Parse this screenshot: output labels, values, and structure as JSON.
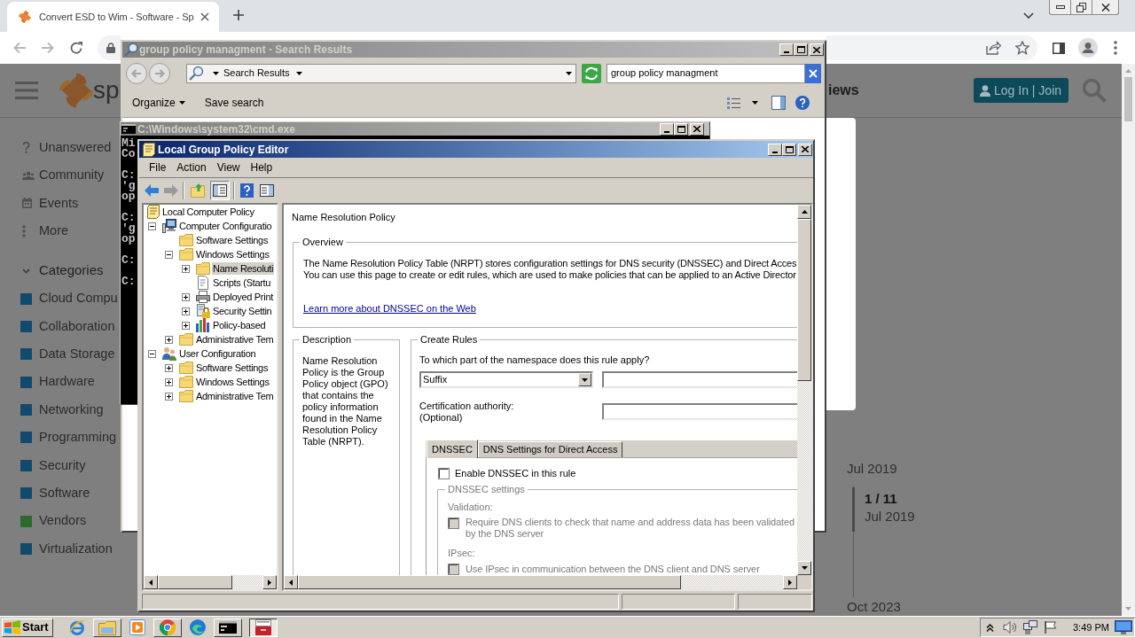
{
  "browser": {
    "tab_title": "Convert ESD to Wim - Software - Sp",
    "page": {
      "logo_text": "sp",
      "nav_link": "iews",
      "login_button": "Log In | Join",
      "sidebar": [
        {
          "label": "Unanswered"
        },
        {
          "label": "Community"
        },
        {
          "label": "Events"
        },
        {
          "label": "More"
        }
      ],
      "categories": {
        "heading": "Categories",
        "expanded": true,
        "items": [
          {
            "label": "Cloud Compu",
            "color": "#124a6e"
          },
          {
            "label": "Collaboration",
            "color": "#124a6e"
          },
          {
            "label": "Data Storage",
            "color": "#124a6e"
          },
          {
            "label": "Hardware",
            "color": "#124a6e"
          },
          {
            "label": "Networking",
            "color": "#124a6e"
          },
          {
            "label": "Programming",
            "color": "#124a6e"
          },
          {
            "label": "Security",
            "color": "#124a6e"
          },
          {
            "label": "Software",
            "color": "#124a6e"
          },
          {
            "label": "Vendors",
            "color": "#2d6a2d"
          },
          {
            "label": "Virtualization",
            "color": "#124a6e"
          }
        ]
      },
      "timeline": {
        "start": "Jul 2019",
        "position": "1 / 11",
        "position_date": "Jul 2019",
        "end": "Oct 2023"
      }
    }
  },
  "search_window": {
    "title": "group policy managment - Search Results",
    "location": "Search Results",
    "search_value": "group policy managment",
    "commands": [
      {
        "label": "Organize",
        "kind": "menu"
      },
      {
        "label": "Save search",
        "kind": "button"
      }
    ]
  },
  "cmd_window": {
    "title": "C:\\Windows\\system32\\cmd.exe",
    "blocks": [
      [
        "Mi",
        "Co"
      ],
      [
        "C:",
        "'g",
        "op"
      ],
      [
        "C:",
        "'g",
        "op"
      ],
      [
        "C:"
      ],
      [
        "C:"
      ]
    ]
  },
  "gpo_window": {
    "title": "Local Group Policy Editor",
    "menu": [
      "File",
      "Action",
      "View",
      "Help"
    ],
    "tree": [
      {
        "label": "Local Computer Policy",
        "kind": "policy",
        "selected": false,
        "children": [
          {
            "label": "Computer Configuratio",
            "kind": "computer",
            "expanded": true,
            "selected": false,
            "children": [
              {
                "label": "Software Settings",
                "kind": "folder",
                "selected": false
              },
              {
                "label": "Windows Settings",
                "kind": "folder",
                "expanded": true,
                "selected": false,
                "children": [
                  {
                    "label": "Name Resoluti",
                    "kind": "folder",
                    "expanded": false,
                    "selected": true
                  },
                  {
                    "label": "Scripts (Startu",
                    "kind": "script",
                    "selected": false
                  },
                  {
                    "label": "Deployed Print",
                    "kind": "printer",
                    "expanded": false,
                    "selected": false
                  },
                  {
                    "label": "Security Settin",
                    "kind": "security",
                    "expanded": false,
                    "selected": false
                  },
                  {
                    "label": "Policy-based",
                    "kind": "chart",
                    "expanded": false,
                    "selected": false
                  }
                ]
              },
              {
                "label": "Administrative Tem",
                "kind": "folder",
                "expanded": false,
                "selected": false
              }
            ]
          },
          {
            "label": "User Configuration",
            "kind": "user",
            "expanded": true,
            "selected": false,
            "children": [
              {
                "label": "Software Settings",
                "kind": "folder",
                "expanded": false,
                "selected": false
              },
              {
                "label": "Windows Settings",
                "kind": "folder",
                "expanded": false,
                "selected": false
              },
              {
                "label": "Administrative Tem",
                "kind": "folder",
                "expanded": false,
                "selected": false
              }
            ]
          }
        ]
      }
    ],
    "details": {
      "heading": "Name Resolution Policy",
      "overview": {
        "legend": "Overview",
        "lines": [
          "The Name Resolution Policy Table (NRPT) stores configuration settings for DNS security (DNSSEC) and Direct Acces",
          "You can use this page to create or edit rules, which are used to make policies that can be applied to an Active Director"
        ],
        "link": "Learn more about DNSSEC on the Web"
      },
      "description": {
        "legend": "Description",
        "text": "Name Resolution Policy is the Group Policy object (GPO) that contains the policy information found in the Name Resolution Policy Table (NRPT)."
      },
      "create_rules": {
        "legend": "Create Rules",
        "namespace_label": "To which part of the namespace does this rule apply?",
        "namespace_type": "Suffix",
        "ca_label": "Certification authority:",
        "ca_hint": "(Optional)",
        "tabs": [
          {
            "label": "DNSSEC",
            "selected": true
          },
          {
            "label": "DNS Settings for Direct Access",
            "selected": false
          }
        ],
        "enable_option": {
          "label": "Enable DNSSEC in this rule",
          "checked": false
        },
        "settings": {
          "legend": "DNSSEC settings",
          "disabled": true,
          "sections": [
            {
              "heading": "Validation:",
              "option_label": "Require DNS clients to check that name and address data has been validated by the DNS server",
              "checked": false
            },
            {
              "heading": "IPsec:",
              "option_label": "Use IPsec in communication between the DNS client and DNS server",
              "checked": false
            }
          ]
        }
      }
    }
  },
  "taskbar": {
    "start_label": "Start",
    "items": [
      {
        "kind": "launcher"
      },
      {
        "kind": "task",
        "selected": false
      },
      {
        "kind": "launcher"
      },
      {
        "kind": "task",
        "selected": false
      },
      {
        "kind": "launcher"
      },
      {
        "kind": "task",
        "selected": false
      },
      {
        "kind": "task",
        "selected": true
      }
    ],
    "clock": "3:49 PM"
  }
}
